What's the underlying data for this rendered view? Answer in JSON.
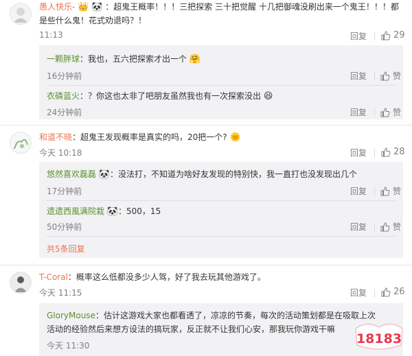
{
  "actions": {
    "reply": "回复",
    "like": "赞"
  },
  "colors": {
    "username": "#eb7350",
    "reply_username": "#5c8f2a",
    "meta": "#808080",
    "reply_bg": "#f2f2f5"
  },
  "comments": [
    {
      "username": "愚人快乐-",
      "text": "：超鬼王概率！！！三把探索 三十把觉醒 十几把御魂没刷出来一个鬼王！！！都是些什么鬼！花式劝退吗？！",
      "time": "11:13",
      "likes": "29",
      "replies": [
        {
          "username": "一颗胖球",
          "text": "：我也，五六把探索才出一个",
          "time": "16分钟前"
        },
        {
          "username": "衣磷蓝火",
          "text": "：？你这也太非了吧朋友虽然我也有一次探索没出",
          "time": "24分钟前"
        }
      ]
    },
    {
      "username": "和道不晓",
      "text": "：超鬼王发现概率是真实的吗，20把一个?",
      "time": "今天 10:18",
      "likes": "28",
      "replies": [
        {
          "username": "悠然喜欢磊磊",
          "text": "：没法打，不知道为啥好友发现的特别快，我一直打也没发现出几个",
          "time": "17分钟前"
        },
        {
          "username": "遗遗西風满院栽",
          "text": "：500，15",
          "time": "50分钟前"
        }
      ],
      "more": "共5条回复"
    },
    {
      "username": "T-Coral",
      "text": "：概率这么低都没多少人驾，好了我去玩其他游戏了。",
      "time": "今天 11:15",
      "likes": "26",
      "replies": [
        {
          "username": "GloryMouse",
          "text": "：估计这游戏大家也都看透了，凉凉的节奏，每次的活动策划都是在吸取上次活动的经验然后来想方设法的搞玩家，反正就不让我们心安，那我玩你游戏干嘛",
          "time": "今天 11:30"
        }
      ]
    }
  ],
  "watermark": "18183"
}
